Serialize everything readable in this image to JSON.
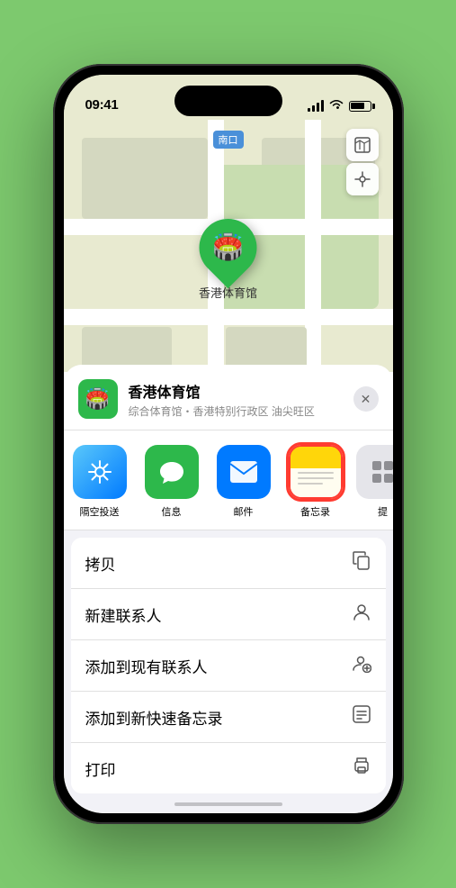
{
  "status_bar": {
    "time": "09:41",
    "arrow_icon": "▶"
  },
  "map": {
    "label": "南口",
    "venue_pin_label": "香港体育馆"
  },
  "venue": {
    "name": "香港体育馆",
    "subtitle": "综合体育馆・香港特别行政区 油尖旺区",
    "icon_emoji": "🏟️"
  },
  "share_items": [
    {
      "id": "airdrop",
      "label": "隔空投送",
      "type": "airdrop"
    },
    {
      "id": "messages",
      "label": "信息",
      "type": "messages"
    },
    {
      "id": "mail",
      "label": "邮件",
      "type": "mail"
    },
    {
      "id": "notes",
      "label": "备忘录",
      "type": "notes",
      "selected": true
    }
  ],
  "more_label": "提",
  "actions": [
    {
      "id": "copy",
      "label": "拷贝",
      "icon": "⎘"
    },
    {
      "id": "new-contact",
      "label": "新建联系人",
      "icon": "👤"
    },
    {
      "id": "add-contact",
      "label": "添加到现有联系人",
      "icon": "👤"
    },
    {
      "id": "quick-note",
      "label": "添加到新快速备忘录",
      "icon": "🗒"
    },
    {
      "id": "print",
      "label": "打印",
      "icon": "🖨"
    }
  ]
}
